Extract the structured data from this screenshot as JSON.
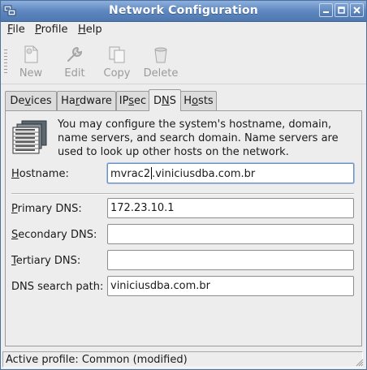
{
  "window": {
    "title": "Network Configuration"
  },
  "menubar": {
    "file": {
      "mnemonic": "F",
      "rest": "ile"
    },
    "profile": {
      "mnemonic": "P",
      "rest": "rofile"
    },
    "help": {
      "mnemonic": "H",
      "rest": "elp"
    }
  },
  "toolbar": {
    "new": "New",
    "edit": "Edit",
    "copy": "Copy",
    "delete": "Delete"
  },
  "tabs": {
    "devices": {
      "pre": "De",
      "mn": "v",
      "post": "ices"
    },
    "hardware": {
      "pre": "Ha",
      "mn": "r",
      "post": "dware"
    },
    "ipsec": {
      "pre": "IP",
      "mn": "s",
      "post": "ec"
    },
    "dns": {
      "pre": "D",
      "mn": "N",
      "post": "S"
    },
    "hosts": {
      "pre": "H",
      "mn": "o",
      "post": "sts"
    },
    "active": "dns"
  },
  "dns": {
    "intro": "You may configure the system's hostname, domain, name servers, and search domain. Name servers are used to look up other hosts on the network.",
    "hostname": {
      "mn": "H",
      "rest": "ostname:",
      "value_before_caret": "mvrac2",
      "value_after_caret": ".viniciusdba.com.br"
    },
    "primary": {
      "pre": "",
      "mn": "P",
      "rest": "rimary DNS:",
      "value": "172.23.10.1"
    },
    "secondary": {
      "pre": "",
      "mn": "S",
      "rest": "econdary DNS:",
      "value": ""
    },
    "tertiary": {
      "pre": "",
      "mn": "T",
      "rest": "ertiary DNS:",
      "value": ""
    },
    "search": {
      "pre": "DNS search path:",
      "value": "viniciusdba.com.br"
    }
  },
  "status": {
    "text": "Active profile: Common (modified)"
  }
}
